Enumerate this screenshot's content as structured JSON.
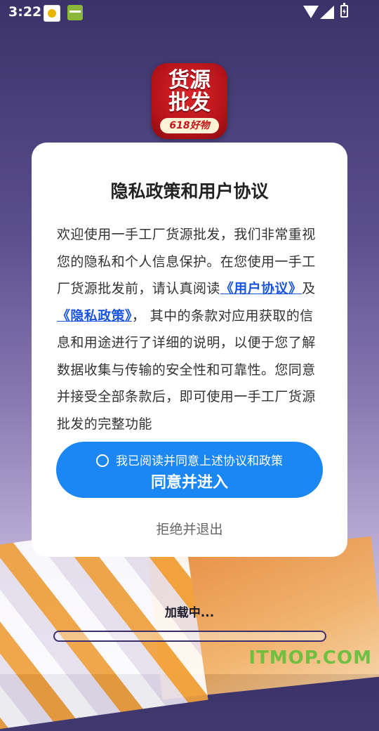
{
  "status_bar": {
    "time": "3:22",
    "icons": [
      "notification-app-icon",
      "notification-app-icon",
      "wifi-icon",
      "signal-icon",
      "battery-charging-icon"
    ]
  },
  "app_logo": {
    "line1": "货源",
    "line2": "批发",
    "sub": "618好物"
  },
  "dialog": {
    "title": "隐私政策和用户协议",
    "body_part1": "欢迎使用一手工厂货源批发，我们非常重视您的隐私和个人信息保护。在您使用一手工厂货源批发前，请认真阅读",
    "link_user_agreement": "《用户协议》",
    "body_and": "及",
    "link_privacy_policy": "《隐私政策》",
    "body_part2": "， 其中的条款对应用获取的信息和用途进行了详细的说明，以便于您了解数据收集与传输的安全性和可靠性。您同意并接受全部条款后，即可使用一手工厂货源批发的完整功能",
    "checkbox_label": "我已阅读并同意上述协议和政策",
    "agree_button": "同意并进入",
    "reject_button": "拒绝并退出"
  },
  "loading": {
    "text": "加载中...",
    "progress": 0
  },
  "watermark": "ITMOP.COM",
  "colors": {
    "accent": "#1b87f5",
    "link": "#1a56e0",
    "progress_border": "#3c2f6e"
  }
}
